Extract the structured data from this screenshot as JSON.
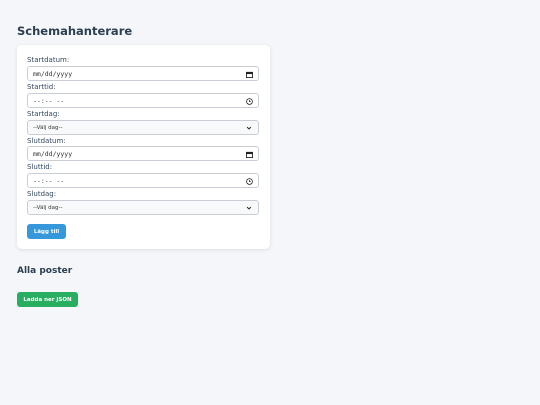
{
  "title": "Schemahanterare",
  "form": {
    "start_date_label": "Startdatum:",
    "start_date_placeholder": "mm/dd/yyyy",
    "start_time_label": "Starttid:",
    "start_time_placeholder": "--:-- --",
    "start_day_label": "Startdag:",
    "start_day_value": "--Välj dag--",
    "end_date_label": "Slutdatum:",
    "end_date_placeholder": "mm/dd/yyyy",
    "end_time_label": "Sluttid:",
    "end_time_placeholder": "--:-- --",
    "end_day_label": "Slutdag:",
    "end_day_value": "--Välj dag--",
    "add_button_label": "Lägg till"
  },
  "posts": {
    "title": "Alla poster",
    "download_button_label": "Ladda ner JSON"
  },
  "colors": {
    "primary": "#3498db",
    "success": "#27ae60",
    "heading": "#2c3e50",
    "background": "#f4f6f9"
  },
  "icons": {
    "date": "calendar-icon",
    "time": "clock-icon",
    "select": "chevron-down-icon"
  }
}
